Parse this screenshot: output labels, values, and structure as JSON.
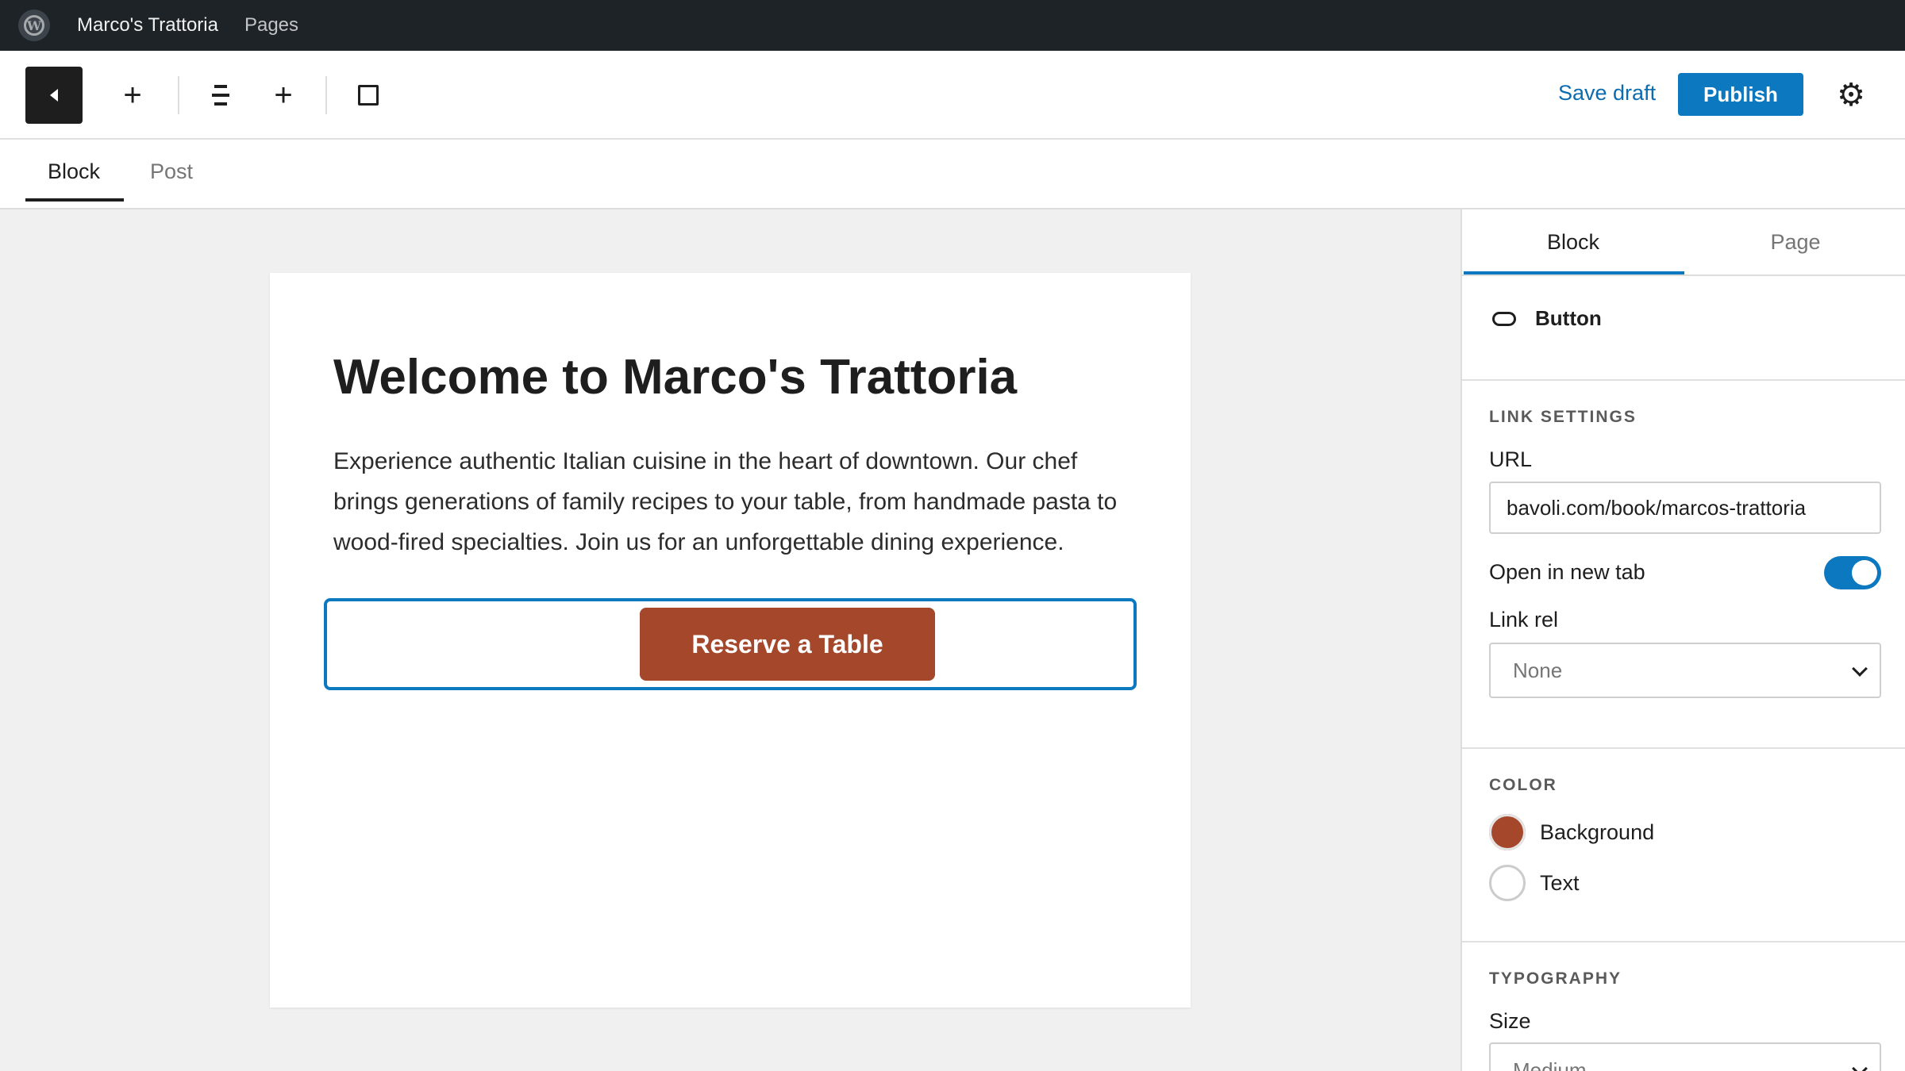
{
  "admin_bar": {
    "site_name": "Marco's Trattoria",
    "pages_link": "Pages"
  },
  "toolbar": {
    "save_draft": "Save draft",
    "publish": "Publish"
  },
  "tabs": [
    {
      "label": "Block",
      "active": true
    },
    {
      "label": "Post",
      "active": false
    }
  ],
  "canvas": {
    "heading": "Welcome to Marco's Trattoria",
    "body": "Experience authentic Italian cuisine in the heart of downtown. Our chef brings generations of family recipes to your table, from handmade pasta to wood-fired specialties. Join us for an unforgettable dining experience.",
    "button_label": "Reserve a Table",
    "button_color": "#a4472b"
  },
  "sidebar": {
    "tabs": [
      {
        "label": "Block",
        "active": true
      },
      {
        "label": "Page",
        "active": false
      }
    ],
    "block_name": "Button",
    "link_settings": {
      "title": "LINK SETTINGS",
      "url_label": "URL",
      "url_value": "bavoli.com/book/marcos-trattoria",
      "new_tab_label": "Open in new tab",
      "new_tab_enabled": true,
      "rel_label": "Link rel",
      "rel_value": "None"
    },
    "color": {
      "title": "COLOR",
      "background_label": "Background",
      "text_label": "Text"
    },
    "typography": {
      "title": "TYPOGRAPHY",
      "size_label": "Size",
      "size_value": "Medium"
    }
  },
  "colors": {
    "accent": "#0b78bf",
    "admin_bar": "#1d2327"
  }
}
